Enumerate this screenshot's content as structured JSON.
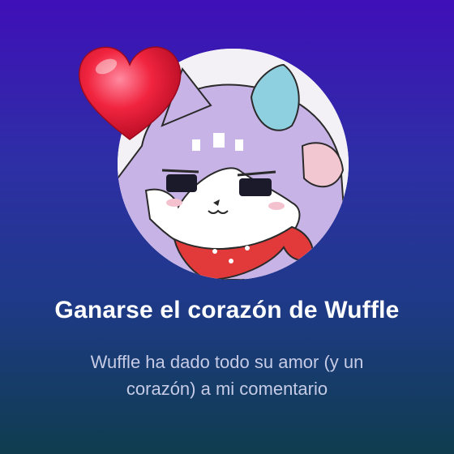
{
  "achievement": {
    "title": "Ganarse el corazón de Wuffle",
    "description": "Wuffle ha dado todo su amor (y un corazón) a mi comentario",
    "icons": {
      "badge": "wuffle-avatar",
      "heart": "heart-icon"
    }
  },
  "colors": {
    "background_top": "#3f0fb8",
    "background_bottom": "#0f3d4e",
    "title": "#ffffff",
    "description": "#c6cbe6",
    "heart": "#e8143a"
  }
}
